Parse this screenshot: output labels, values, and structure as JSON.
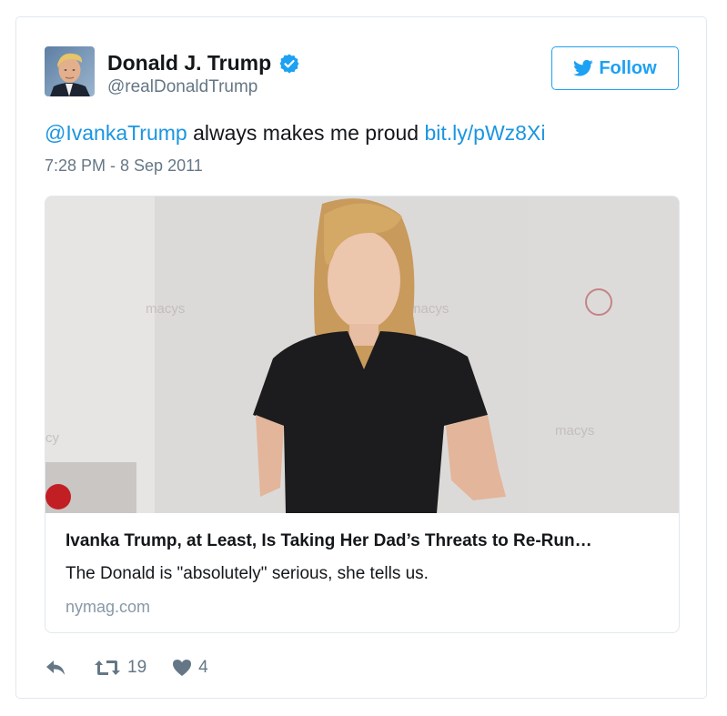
{
  "user": {
    "name": "Donald J. Trump",
    "handle": "@realDonaldTrump",
    "verified_icon": "verified-badge-icon",
    "avatar_icon": "profile-photo"
  },
  "follow": {
    "label": "Follow",
    "icon": "twitter-bird-icon"
  },
  "tweet": {
    "mention": "@IvankaTrump",
    "text": " always makes me proud ",
    "link": "bit.ly/pWz8Xi",
    "timestamp": "7:28 PM - 8 Sep 2011"
  },
  "card": {
    "image_desc": "photo",
    "title": "Ivanka Trump, at Least, Is Taking Her Dad’s Threats to Re-Run…",
    "description": "The Donald is \"absolutely\" serious, she tells us.",
    "domain": "nymag.com"
  },
  "actions": {
    "reply_icon": "reply-icon",
    "retweet_icon": "retweet-icon",
    "retweet_count": "19",
    "like_icon": "heart-icon",
    "like_count": "4"
  },
  "colors": {
    "accent": "#1da1f2",
    "link": "#1b95e0",
    "muted": "#657786",
    "border": "#e1e8ed"
  }
}
